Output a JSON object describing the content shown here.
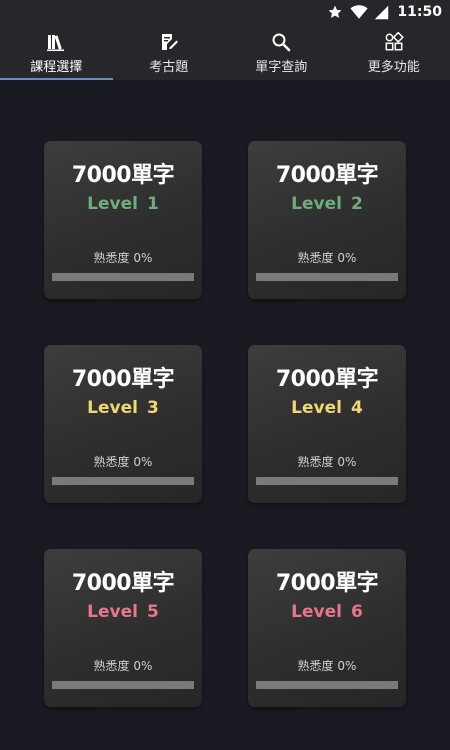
{
  "status_bar": {
    "time": "11:50",
    "icons": [
      "star-icon",
      "wifi-icon",
      "signal-icon"
    ]
  },
  "tabs": [
    {
      "label": "課程選擇",
      "icon": "books-icon",
      "active": true
    },
    {
      "label": "考古題",
      "icon": "edit-note-icon",
      "active": false
    },
    {
      "label": "單字查詢",
      "icon": "search-icon",
      "active": false
    },
    {
      "label": "更多功能",
      "icon": "apps-icon",
      "active": false
    }
  ],
  "colors": {
    "tab_indicator": "#6f87c9",
    "level_green": "#6dae7c",
    "level_yellow": "#f0d774",
    "level_pink": "#e8768c",
    "background": "#1a1b22",
    "bar": "#25272b"
  },
  "cards": [
    {
      "title": "7000單字",
      "level_word": "Level",
      "level_num": "1",
      "color": "#6dae7c",
      "familiarity_label": "熟悉度",
      "familiarity_value": "0%",
      "progress": 0
    },
    {
      "title": "7000單字",
      "level_word": "Level",
      "level_num": "2",
      "color": "#6dae7c",
      "familiarity_label": "熟悉度",
      "familiarity_value": "0%",
      "progress": 0
    },
    {
      "title": "7000單字",
      "level_word": "Level",
      "level_num": "3",
      "color": "#f0d774",
      "familiarity_label": "熟悉度",
      "familiarity_value": "0%",
      "progress": 0
    },
    {
      "title": "7000單字",
      "level_word": "Level",
      "level_num": "4",
      "color": "#f0d774",
      "familiarity_label": "熟悉度",
      "familiarity_value": "0%",
      "progress": 0
    },
    {
      "title": "7000單字",
      "level_word": "Level",
      "level_num": "5",
      "color": "#e8768c",
      "familiarity_label": "熟悉度",
      "familiarity_value": "0%",
      "progress": 0
    },
    {
      "title": "7000單字",
      "level_word": "Level",
      "level_num": "6",
      "color": "#e8768c",
      "familiarity_label": "熟悉度",
      "familiarity_value": "0%",
      "progress": 0
    }
  ]
}
